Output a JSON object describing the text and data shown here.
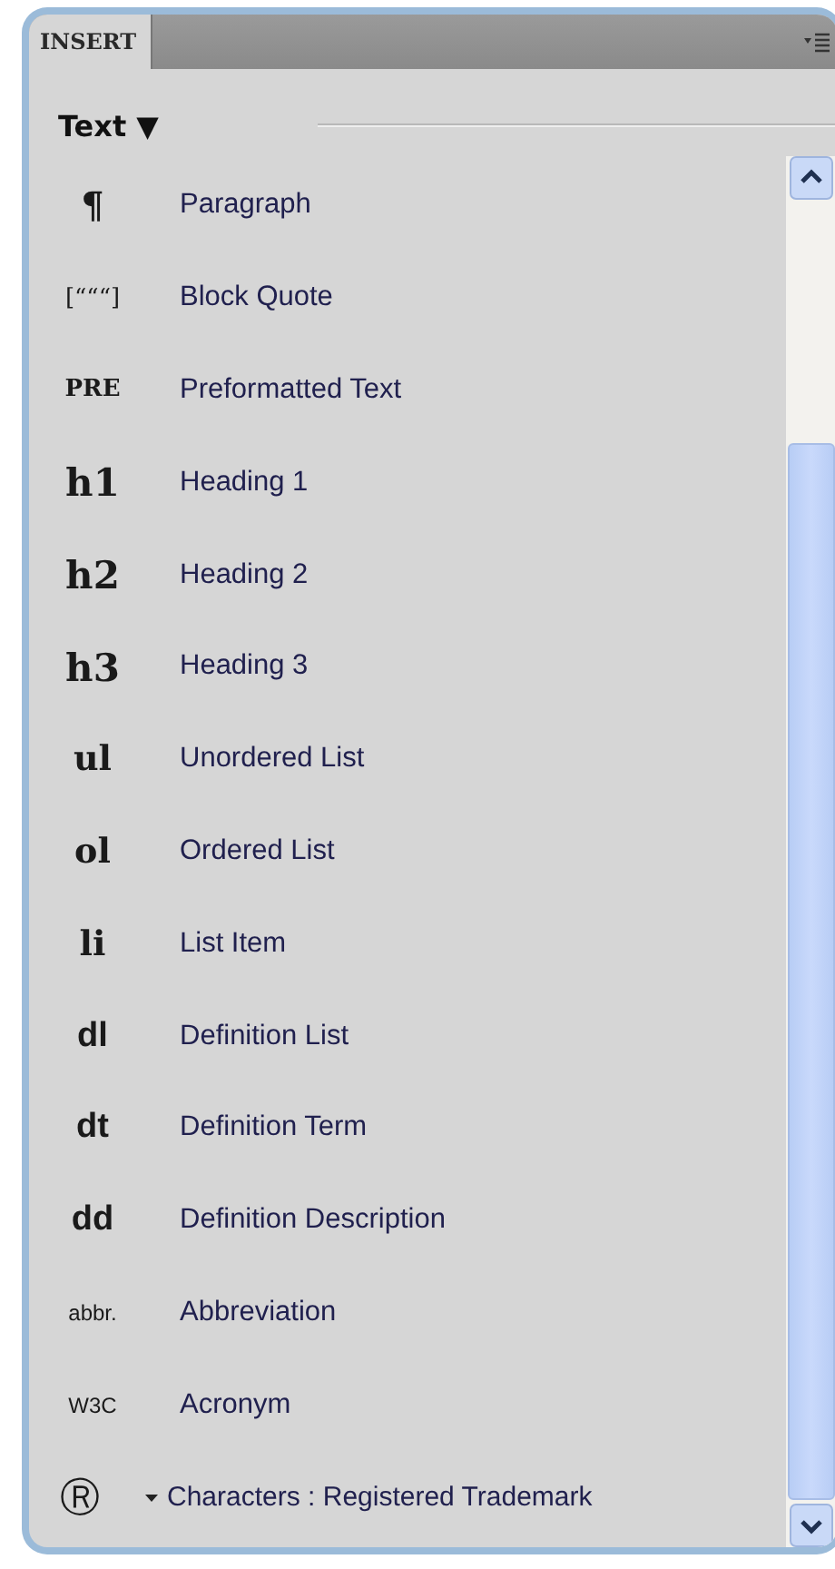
{
  "panel": {
    "tab": "INSERT",
    "category": "Text ▼",
    "items": [
      {
        "kind": "symbol",
        "glyph": "¶",
        "label": "Paragraph"
      },
      {
        "kind": "quote",
        "glyph": "[“““]",
        "label": "Block Quote"
      },
      {
        "kind": "serif-small",
        "glyph": "PRE",
        "label": "Preformatted Text"
      },
      {
        "kind": "serif-large",
        "glyph": "h1",
        "label": "Heading 1"
      },
      {
        "kind": "serif-large",
        "glyph": "h2",
        "label": "Heading 2"
      },
      {
        "kind": "serif-large",
        "glyph": "h3",
        "label": "Heading 3"
      },
      {
        "kind": "serif-bold",
        "glyph": "ul",
        "label": "Unordered List"
      },
      {
        "kind": "serif-bold",
        "glyph": "ol",
        "label": "Ordered List"
      },
      {
        "kind": "serif-bold",
        "glyph": "li",
        "label": "List Item"
      },
      {
        "kind": "sans-bold",
        "glyph": "dl",
        "label": "Definition List"
      },
      {
        "kind": "sans-bold",
        "glyph": "dt",
        "label": "Definition Term"
      },
      {
        "kind": "sans-bold",
        "glyph": "dd",
        "label": "Definition Description"
      },
      {
        "kind": "small",
        "glyph": "abbr.",
        "label": "Abbreviation"
      },
      {
        "kind": "small",
        "glyph": "W3C",
        "label": "Acronym"
      },
      {
        "kind": "menu",
        "glyph": "Ⓡ",
        "label": "Characters : Registered Trademark"
      }
    ]
  }
}
